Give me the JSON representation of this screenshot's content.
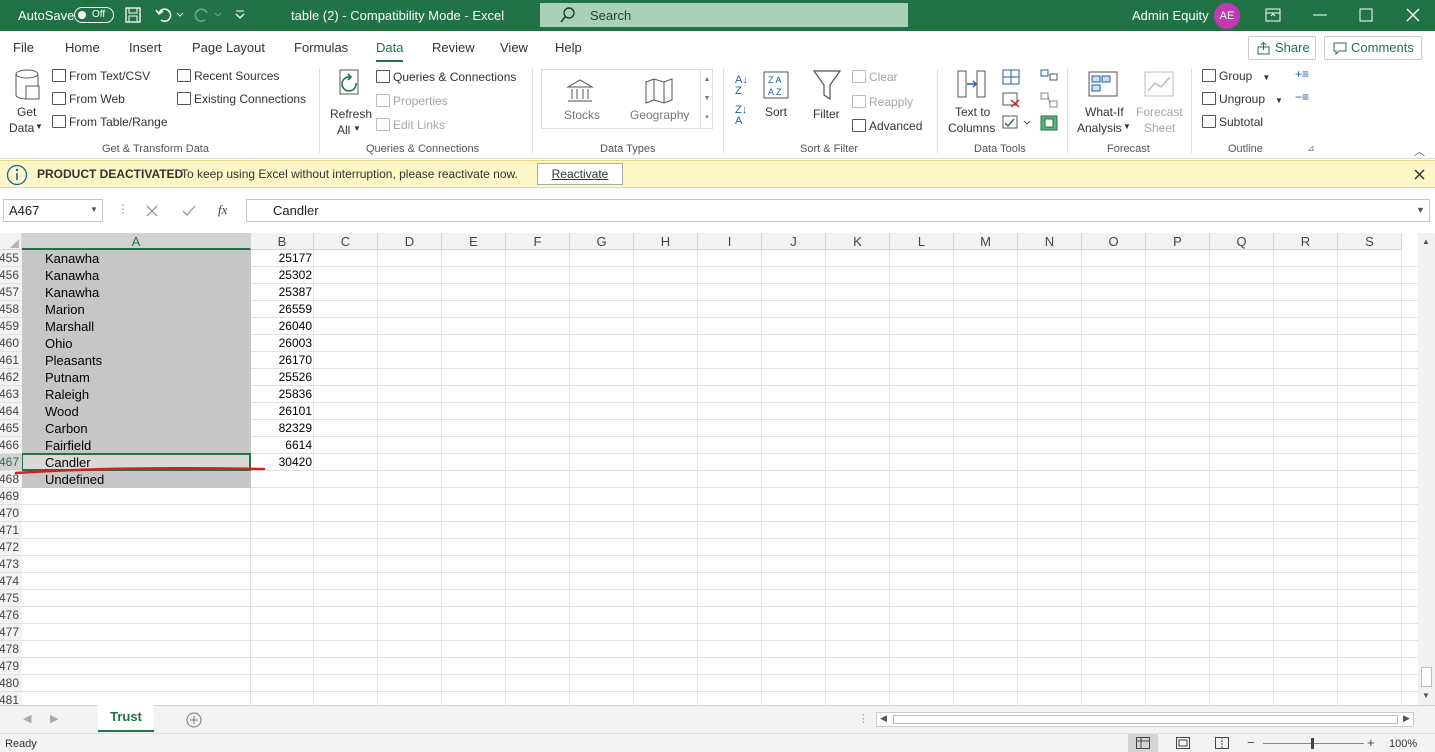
{
  "titlebar": {
    "autosave_label": "AutoSave",
    "autosave_state": "Off",
    "doc_title": "table (2)  -  Compatibility Mode  -  Excel",
    "search_placeholder": "Search",
    "user_name": "Admin Equity",
    "user_initials": "AE"
  },
  "menu": {
    "items": [
      "File",
      "Home",
      "Insert",
      "Page Layout",
      "Formulas",
      "Data",
      "Review",
      "View",
      "Help"
    ],
    "active": "Data",
    "share_label": "Share",
    "comments_label": "Comments"
  },
  "ribbon": {
    "get_data": {
      "line1": "Get",
      "line2": "Data"
    },
    "from_text_csv": "From Text/CSV",
    "from_web": "From Web",
    "from_table_range": "From Table/Range",
    "recent_sources": "Recent Sources",
    "existing_connections": "Existing Connections",
    "group_get_transform": "Get & Transform Data",
    "refresh": {
      "line1": "Refresh",
      "line2": "All"
    },
    "queries_connections": "Queries & Connections",
    "properties": "Properties",
    "edit_links": "Edit Links",
    "group_queries": "Queries & Connections",
    "stocks": "Stocks",
    "geography": "Geography",
    "group_data_types": "Data Types",
    "sort": "Sort",
    "filter": "Filter",
    "clear": "Clear",
    "reapply": "Reapply",
    "advanced": "Advanced",
    "group_sort_filter": "Sort & Filter",
    "text_to_columns": {
      "line1": "Text to",
      "line2": "Columns"
    },
    "group_data_tools": "Data Tools",
    "what_if": {
      "line1": "What-If",
      "line2": "Analysis"
    },
    "forecast_sheet": {
      "line1": "Forecast",
      "line2": "Sheet"
    },
    "group_forecast": "Forecast",
    "group": "Group",
    "ungroup": "Ungroup",
    "subtotal": "Subtotal",
    "group_outline": "Outline"
  },
  "banner": {
    "title": "PRODUCT DEACTIVATED",
    "message": "To keep using Excel without interruption, please reactivate now.",
    "button": "Reactivate"
  },
  "formula_bar": {
    "name_box": "A467",
    "fx": "fx",
    "value": "Candler"
  },
  "columns": [
    "A",
    "B",
    "C",
    "D",
    "E",
    "F",
    "G",
    "H",
    "I",
    "J",
    "K",
    "L",
    "M",
    "N",
    "O",
    "P",
    "Q",
    "R",
    "S"
  ],
  "rows": [
    {
      "num": "455",
      "a": "Kanawha",
      "b": "25177"
    },
    {
      "num": "456",
      "a": "Kanawha",
      "b": "25302"
    },
    {
      "num": "457",
      "a": "Kanawha",
      "b": "25387"
    },
    {
      "num": "458",
      "a": "Marion",
      "b": "26559"
    },
    {
      "num": "459",
      "a": "Marshall",
      "b": "26040"
    },
    {
      "num": "460",
      "a": "Ohio",
      "b": "26003"
    },
    {
      "num": "461",
      "a": "Pleasants",
      "b": "26170"
    },
    {
      "num": "462",
      "a": "Putnam",
      "b": "25526"
    },
    {
      "num": "463",
      "a": "Raleigh",
      "b": "25836"
    },
    {
      "num": "464",
      "a": "Wood",
      "b": "26101"
    },
    {
      "num": "465",
      "a": "Carbon",
      "b": "82329"
    },
    {
      "num": "466",
      "a": "Fairfield",
      "b": "6614"
    },
    {
      "num": "467",
      "a": "Candler",
      "b": "30420"
    },
    {
      "num": "468",
      "a": "Undefined",
      "b": ""
    },
    {
      "num": "469",
      "a": "",
      "b": ""
    },
    {
      "num": "470",
      "a": "",
      "b": ""
    },
    {
      "num": "471",
      "a": "",
      "b": ""
    },
    {
      "num": "472",
      "a": "",
      "b": ""
    },
    {
      "num": "473",
      "a": "",
      "b": ""
    },
    {
      "num": "474",
      "a": "",
      "b": ""
    },
    {
      "num": "475",
      "a": "",
      "b": ""
    },
    {
      "num": "476",
      "a": "",
      "b": ""
    },
    {
      "num": "477",
      "a": "",
      "b": ""
    },
    {
      "num": "478",
      "a": "",
      "b": ""
    },
    {
      "num": "479",
      "a": "",
      "b": ""
    },
    {
      "num": "480",
      "a": "",
      "b": ""
    },
    {
      "num": "481",
      "a": "",
      "b": ""
    }
  ],
  "sheet_tabs": [
    "Trust"
  ],
  "status": {
    "ready": "Ready",
    "zoom": "100%"
  },
  "colors": {
    "brand": "#217346",
    "selection": "#c6c6c6",
    "banner": "#fdf6c7",
    "annotation": "#d42020"
  }
}
